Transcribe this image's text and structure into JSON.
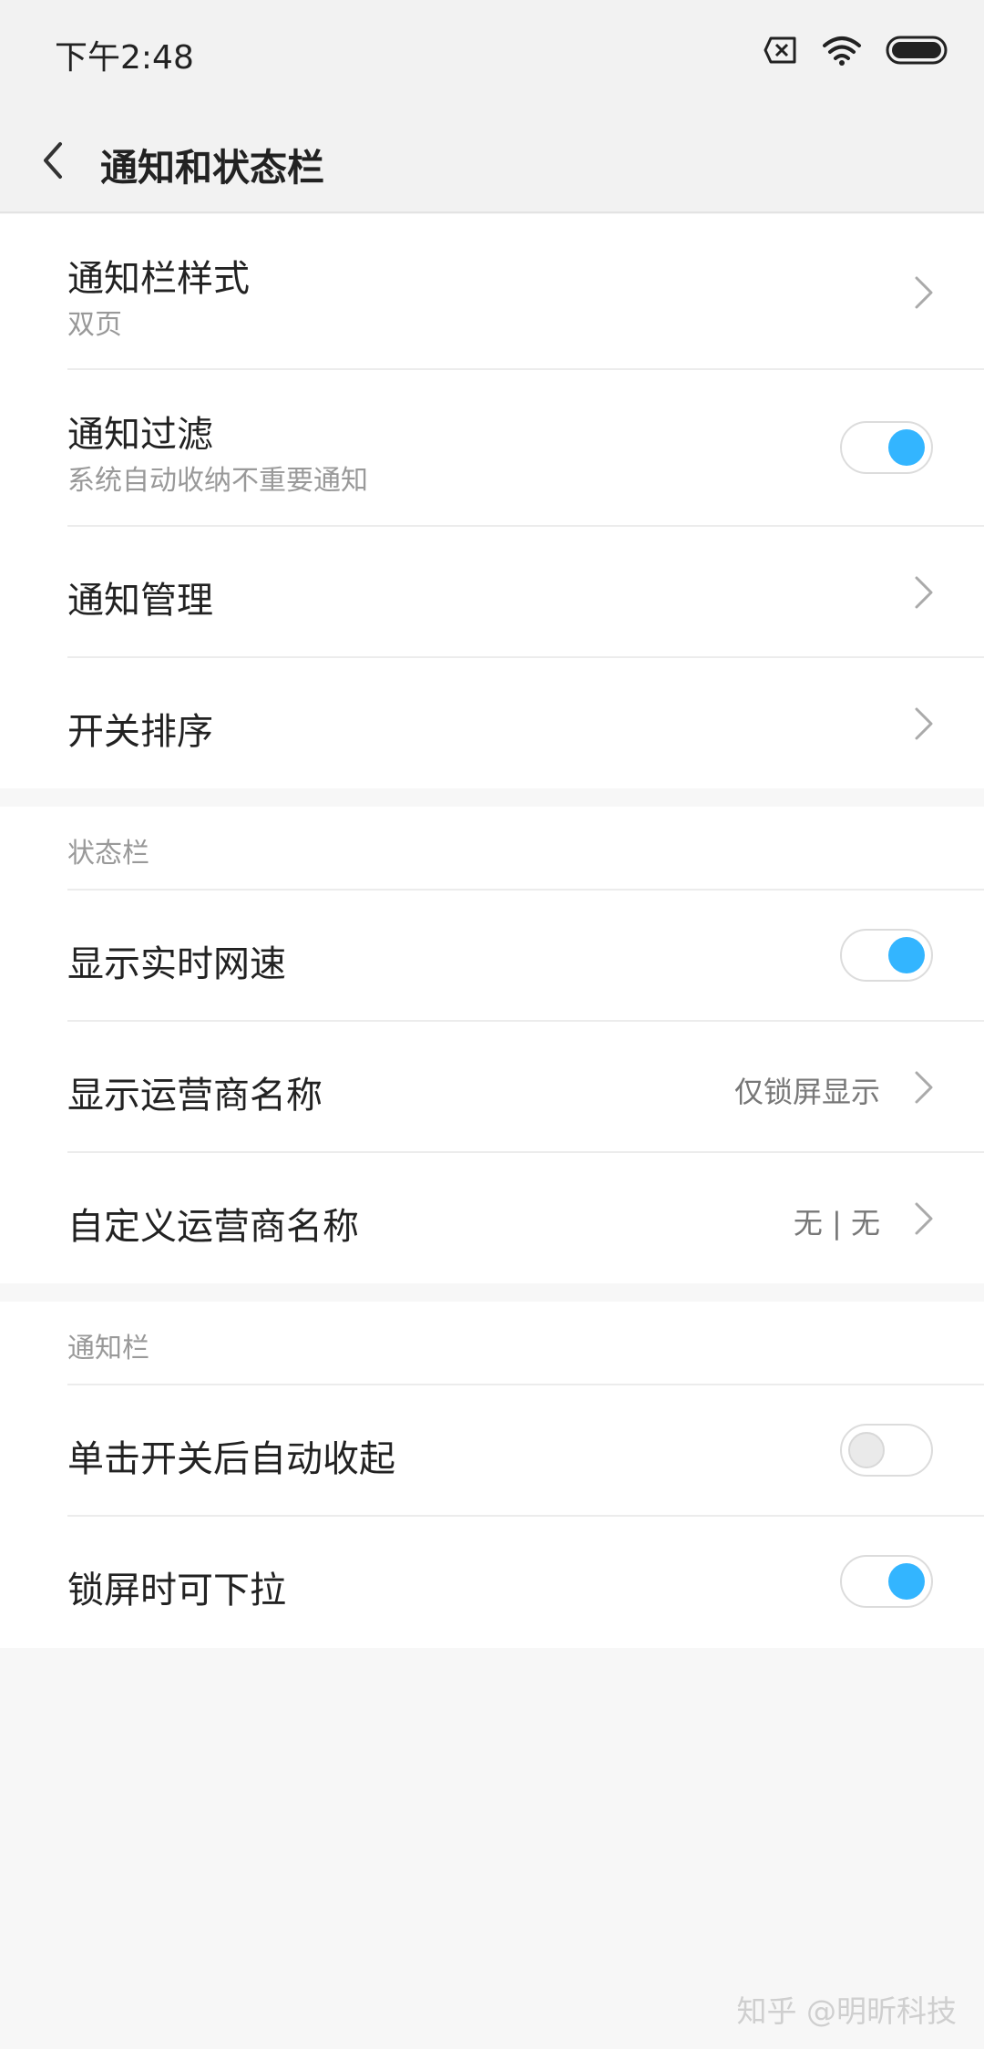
{
  "status_bar": {
    "time": "下午2:48",
    "icons": [
      "sim-error-icon",
      "wifi-icon",
      "battery-icon"
    ]
  },
  "header": {
    "title": "通知和状态栏",
    "back_icon": "chevron-left-icon"
  },
  "group1": {
    "notification_style": {
      "title": "通知栏样式",
      "subtitle": "双页"
    },
    "notification_filter": {
      "title": "通知过滤",
      "subtitle": "系统自动收纳不重要通知",
      "enabled": true
    },
    "notification_manage": {
      "title": "通知管理"
    },
    "switch_order": {
      "title": "开关排序"
    }
  },
  "status_section": {
    "label": "状态栏",
    "show_speed": {
      "title": "显示实时网速",
      "enabled": true
    },
    "show_carrier": {
      "title": "显示运营商名称",
      "value": "仅锁屏显示"
    },
    "custom_carrier": {
      "title": "自定义运营商名称",
      "value": "无 | 无"
    }
  },
  "notif_section": {
    "label": "通知栏",
    "auto_collapse": {
      "title": "单击开关后自动收起",
      "enabled": false
    },
    "lock_pulldown": {
      "title": "锁屏时可下拉",
      "enabled": true
    }
  },
  "watermark": "知乎 @明昕科技",
  "colors": {
    "accent": "#33b5ff",
    "background": "#f7f7f7",
    "header": "#f2f2f2"
  }
}
